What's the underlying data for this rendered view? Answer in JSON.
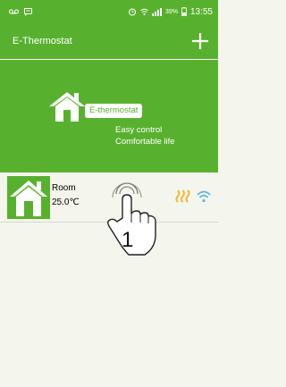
{
  "status_bar": {
    "battery_percent": "39%",
    "time": "13:55"
  },
  "app_bar": {
    "title": "E-Thermostat",
    "add_icon": "plus-icon"
  },
  "banner": {
    "pill_text": "E-thermostat",
    "tagline_1": "Easy control",
    "tagline_2": "Comfortable life"
  },
  "device": {
    "name": "Room",
    "temperature": "25.0℃",
    "icons": [
      "house-icon",
      "heating-icon",
      "wifi-icon"
    ]
  },
  "annotation": {
    "step": "1",
    "icon": "tap-hand-icon"
  },
  "colors": {
    "brand_green": "#58b12e",
    "background": "#f4f5ec",
    "heating_orange": "#f4b62d",
    "wifi_blue": "#58b7e6"
  }
}
